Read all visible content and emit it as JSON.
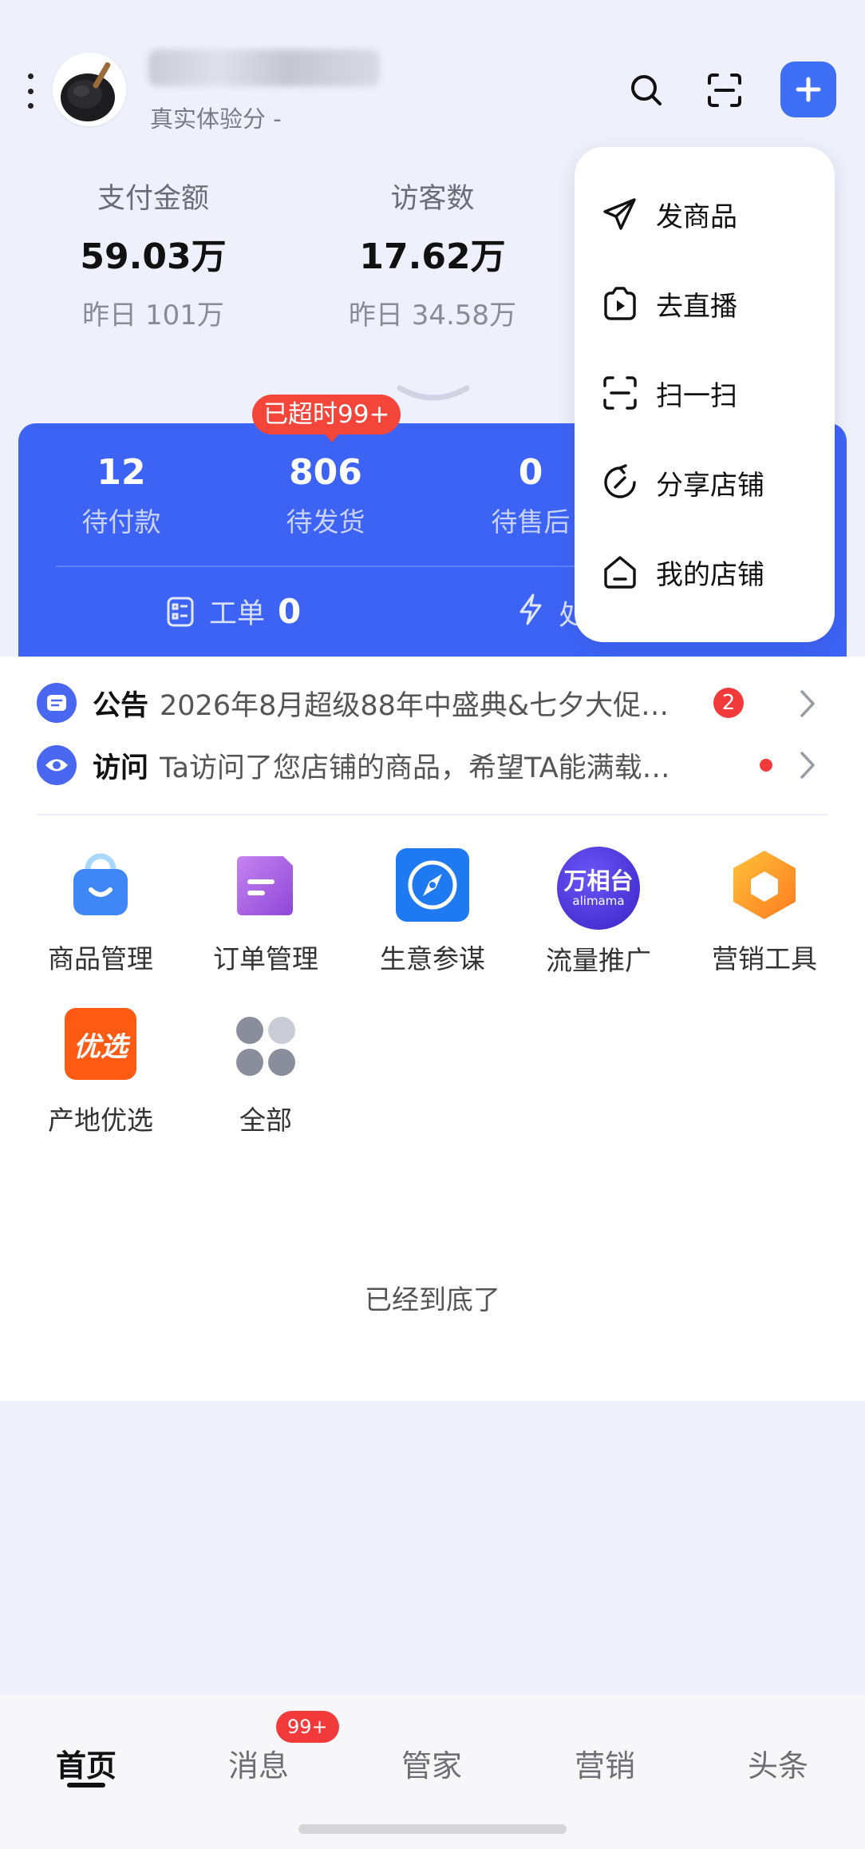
{
  "header": {
    "shop_sub": "真实体验分 -",
    "icons": [
      "more-vertical-icon",
      "search-icon",
      "scan-icon",
      "plus-icon"
    ]
  },
  "stats": [
    {
      "label": "支付金额",
      "value": "59.03万",
      "prev": "昨日 101万"
    },
    {
      "label": "访客数",
      "value": "17.62万",
      "prev": "昨日 34.58万"
    }
  ],
  "orders": {
    "timeout_badge": "已超时99+",
    "items": [
      {
        "count": "12",
        "label": "待付款"
      },
      {
        "count": "806",
        "label": "待发货"
      },
      {
        "count": "0",
        "label": "待售后"
      }
    ],
    "work_order_label": "工单",
    "work_order_count": "0",
    "second_label_partial": "处"
  },
  "notices": [
    {
      "title": "公告",
      "text": "2026年8月超级88年中盛典&七夕大促…",
      "badge": "2"
    },
    {
      "title": "访问",
      "text": "Ta访问了您店铺的商品，希望TA能满载…",
      "badge": ""
    }
  ],
  "tools": [
    {
      "label": "商品管理",
      "icon": "bag-icon"
    },
    {
      "label": "订单管理",
      "icon": "order-doc-icon"
    },
    {
      "label": "生意参谋",
      "icon": "compass-icon"
    },
    {
      "label": "流量推广",
      "icon": "wanxiangtai-icon",
      "logo_text": "万相台",
      "logo_sub": "alimama"
    },
    {
      "label": "营销工具",
      "icon": "hexagon-icon"
    },
    {
      "label": "产地优选",
      "icon": "youxuan-icon",
      "logo_text": "优选"
    },
    {
      "label": "全部",
      "icon": "grid-dots-icon"
    }
  ],
  "end_text": "已经到底了",
  "dropdown": [
    {
      "label": "发商品",
      "icon": "send-icon"
    },
    {
      "label": "去直播",
      "icon": "live-play-icon"
    },
    {
      "label": "扫一扫",
      "icon": "scan-icon"
    },
    {
      "label": "分享店铺",
      "icon": "share-icon"
    },
    {
      "label": "我的店铺",
      "icon": "shop-icon"
    }
  ],
  "tabs": [
    {
      "label": "首页"
    },
    {
      "label": "消息",
      "badge": "99+"
    },
    {
      "label": "管家"
    },
    {
      "label": "营销"
    },
    {
      "label": "头条"
    }
  ],
  "colors": {
    "accent": "#3d63f5",
    "alert": "#f23a3a",
    "background": "#eef0fb"
  }
}
